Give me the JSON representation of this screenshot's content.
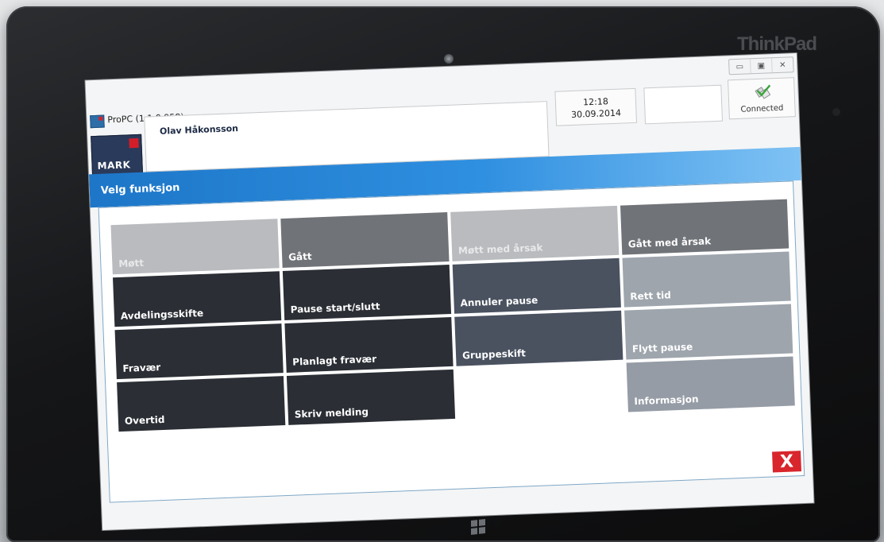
{
  "device": {
    "brand": "ThinkPad"
  },
  "window": {
    "title": "ProPC (1.1.0.958)",
    "controls": [
      "▭",
      "▣",
      "✕"
    ]
  },
  "header": {
    "user_name": "Olav Håkonsson",
    "time": "12:18",
    "date": "30.09.2014",
    "connection_status": "Connected",
    "logo_text": "MARK"
  },
  "section": {
    "title": "Velg funksjon"
  },
  "tiles": [
    [
      "Møtt",
      "Gått",
      "Møtt med årsak",
      "Gått med årsak"
    ],
    [
      "Avdelingsskifte",
      "Pause start/slutt",
      "Annuler pause",
      "Rett tid"
    ],
    [
      "Fravær",
      "Planlagt fravær",
      "Gruppeskift",
      "Flytt pause"
    ],
    [
      "Overtid",
      "Skriv melding",
      "",
      "Informasjon"
    ]
  ],
  "close_label": "X",
  "colors": {
    "header_blue": "#1d76c8",
    "close_red": "#d8262c",
    "logo_navy": "#2a3a5a"
  }
}
